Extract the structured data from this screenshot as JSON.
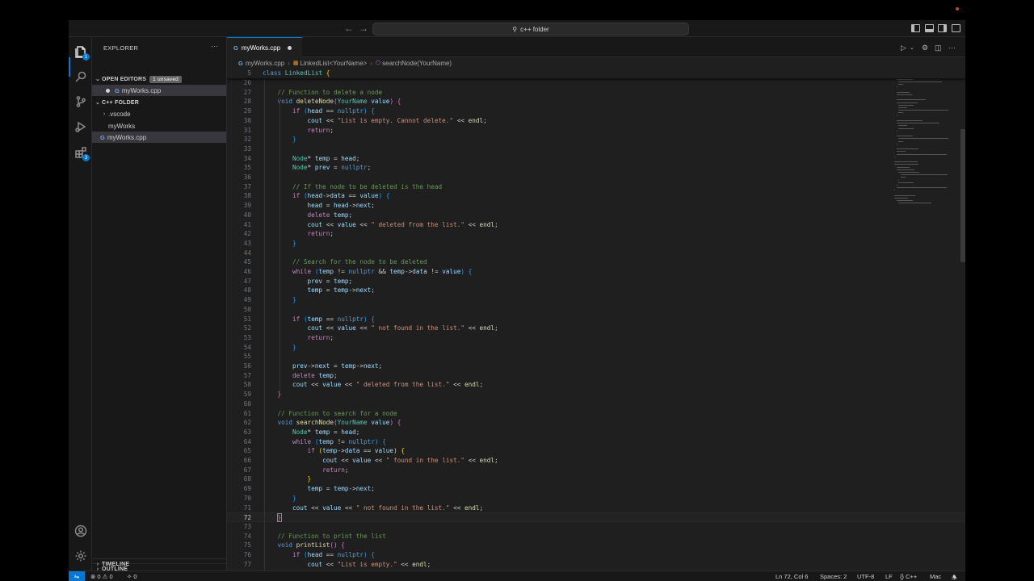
{
  "window": {
    "command_center": "c++ folder"
  },
  "sidebar": {
    "title": "EXPLORER",
    "open_editors": {
      "label": "OPEN EDITORS",
      "badge": "1 unsaved",
      "files": [
        "myWorks.cpp"
      ]
    },
    "folder": {
      "label": "C++ FOLDER",
      "items": [
        ".vscode",
        "myWorks",
        "myWorks.cpp"
      ]
    },
    "outline": "OUTLINE",
    "timeline": "TIMELINE"
  },
  "activity": {
    "explorer_badge": "1",
    "extensions_badge": "3"
  },
  "tab": {
    "label": "myWorks.cpp"
  },
  "breadcrumb": {
    "file": "myWorks.cpp",
    "class": "LinkedList<YourName>",
    "method": "searchNode(YourName)"
  },
  "editor": {
    "current_line": 72,
    "lines": [
      {
        "n": 5,
        "html": "<span class='kd'>class</span> <span class='t'>LinkedList</span> <span class='b1'>{</span>"
      },
      {
        "n": 26,
        "html": ""
      },
      {
        "n": 27,
        "html": "    <span class='c'>// Function to delete a node</span>"
      },
      {
        "n": 28,
        "html": "    <span class='kd'>void</span> <span class='f'>deleteNode</span><span class='b2'>(</span><span class='t'>YourName</span> <span class='v'>value</span><span class='b2'>)</span> <span class='b2'>{</span>"
      },
      {
        "n": 29,
        "html": "        <span class='k'>if</span> <span class='b3'>(</span><span class='v'>head</span> == <span class='kd'>nullptr</span><span class='b3'>)</span> <span class='b3'>{</span>"
      },
      {
        "n": 30,
        "html": "            <span class='v'>cout</span> &lt;&lt; <span class='s'>\"List is empty. Cannot delete.\"</span> &lt;&lt; <span class='f'>endl</span>;"
      },
      {
        "n": 31,
        "html": "            <span class='k'>return</span>;"
      },
      {
        "n": 32,
        "html": "        <span class='b3'>}</span>"
      },
      {
        "n": 33,
        "html": ""
      },
      {
        "n": 34,
        "html": "        <span class='t'>Node</span>* <span class='v'>temp</span> = <span class='v'>head</span>;"
      },
      {
        "n": 35,
        "html": "        <span class='t'>Node</span>* <span class='v'>prev</span> = <span class='kd'>nullptr</span>;"
      },
      {
        "n": 36,
        "html": ""
      },
      {
        "n": 37,
        "html": "        <span class='c'>// If the node to be deleted is the head</span>"
      },
      {
        "n": 38,
        "html": "        <span class='k'>if</span> <span class='b3'>(</span><span class='v'>head</span>-&gt;<span class='v'>data</span> == <span class='v'>value</span><span class='b3'>)</span> <span class='b3'>{</span>"
      },
      {
        "n": 39,
        "html": "            <span class='v'>head</span> = <span class='v'>head</span>-&gt;<span class='v'>next</span>;"
      },
      {
        "n": 40,
        "html": "            <span class='k'>delete</span> <span class='v'>temp</span>;"
      },
      {
        "n": 41,
        "html": "            <span class='v'>cout</span> &lt;&lt; <span class='v'>value</span> &lt;&lt; <span class='s'>\" deleted from the list.\"</span> &lt;&lt; <span class='f'>endl</span>;"
      },
      {
        "n": 42,
        "html": "            <span class='k'>return</span>;"
      },
      {
        "n": 43,
        "html": "        <span class='b3'>}</span>"
      },
      {
        "n": 44,
        "html": ""
      },
      {
        "n": 45,
        "html": "        <span class='c'>// Search for the node to be deleted</span>"
      },
      {
        "n": 46,
        "html": "        <span class='k'>while</span> <span class='b3'>(</span><span class='v'>temp</span> != <span class='kd'>nullptr</span> &amp;&amp; <span class='v'>temp</span>-&gt;<span class='v'>data</span> != <span class='v'>value</span><span class='b3'>)</span> <span class='b3'>{</span>"
      },
      {
        "n": 47,
        "html": "            <span class='v'>prev</span> = <span class='v'>temp</span>;"
      },
      {
        "n": 48,
        "html": "            <span class='v'>temp</span> = <span class='v'>temp</span>-&gt;<span class='v'>next</span>;"
      },
      {
        "n": 49,
        "html": "        <span class='b3'>}</span>"
      },
      {
        "n": 50,
        "html": ""
      },
      {
        "n": 51,
        "html": "        <span class='k'>if</span> <span class='b3'>(</span><span class='v'>temp</span> == <span class='kd'>nullptr</span><span class='b3'>)</span> <span class='b3'>{</span>"
      },
      {
        "n": 52,
        "html": "            <span class='v'>cout</span> &lt;&lt; <span class='v'>value</span> &lt;&lt; <span class='s'>\" not found in the list.\"</span> &lt;&lt; <span class='f'>endl</span>;"
      },
      {
        "n": 53,
        "html": "            <span class='k'>return</span>;"
      },
      {
        "n": 54,
        "html": "        <span class='b3'>}</span>"
      },
      {
        "n": 55,
        "html": ""
      },
      {
        "n": 56,
        "html": "        <span class='v'>prev</span>-&gt;<span class='v'>next</span> = <span class='v'>temp</span>-&gt;<span class='v'>next</span>;"
      },
      {
        "n": 57,
        "html": "        <span class='k'>delete</span> <span class='v'>temp</span>;"
      },
      {
        "n": 58,
        "html": "        <span class='v'>cout</span> &lt;&lt; <span class='v'>value</span> &lt;&lt; <span class='s'>\" deleted from the list.\"</span> &lt;&lt; <span class='f'>endl</span>;"
      },
      {
        "n": 59,
        "html": "    <span class='b2'>}</span>"
      },
      {
        "n": 60,
        "html": ""
      },
      {
        "n": 61,
        "html": "    <span class='c'>// Function to search for a node</span>"
      },
      {
        "n": 62,
        "html": "    <span class='kd'>void</span> <span class='f'>searchNode</span><span class='b2'>(</span><span class='t'>YourName</span> <span class='v'>value</span><span class='b2'>)</span> <span class='b2'>{</span>"
      },
      {
        "n": 63,
        "html": "        <span class='t'>Node</span>* <span class='v'>temp</span> = <span class='v'>head</span>;"
      },
      {
        "n": 64,
        "html": "        <span class='k'>while</span> <span class='b3'>(</span><span class='v'>temp</span> != <span class='kd'>nullptr</span><span class='b3'>)</span> <span class='b3'>{</span>"
      },
      {
        "n": 65,
        "html": "            <span class='k'>if</span> <span class='b1'>(</span><span class='v'>temp</span>-&gt;<span class='v'>data</span> == <span class='v'>value</span><span class='b1'>)</span> <span class='b1'>{</span>"
      },
      {
        "n": 66,
        "html": "                <span class='v'>cout</span> &lt;&lt; <span class='v'>value</span> &lt;&lt; <span class='s'>\" found in the list.\"</span> &lt;&lt; <span class='f'>endl</span>;"
      },
      {
        "n": 67,
        "html": "                <span class='k'>return</span>;"
      },
      {
        "n": 68,
        "html": "            <span class='b1'>}</span>"
      },
      {
        "n": 69,
        "html": "            <span class='v'>temp</span> = <span class='v'>temp</span>-&gt;<span class='v'>next</span>;"
      },
      {
        "n": 70,
        "html": "        <span class='b3'>}</span>"
      },
      {
        "n": 71,
        "html": "        <span class='v'>cout</span> &lt;&lt; <span class='v'>value</span> &lt;&lt; <span class='s'>\" not found in the list.\"</span> &lt;&lt; <span class='f'>endl</span>;"
      },
      {
        "n": 72,
        "html": "    <span class='b2' style='outline:1px solid #888;'>}</span>"
      },
      {
        "n": 73,
        "html": ""
      },
      {
        "n": 74,
        "html": "    <span class='c'>// Function to print the list</span>"
      },
      {
        "n": 75,
        "html": "    <span class='kd'>void</span> <span class='f'>printList</span><span class='b2'>()</span> <span class='b2'>{</span>"
      },
      {
        "n": 76,
        "html": "        <span class='k'>if</span> <span class='b3'>(</span><span class='v'>head</span> == <span class='kd'>nullptr</span><span class='b3'>)</span> <span class='b3'>{</span>"
      },
      {
        "n": 77,
        "html": "            <span class='v'>cout</span> &lt;&lt; <span class='s'>\"List is empty.\"</span> &lt;&lt; <span class='f'>endl</span>;"
      }
    ]
  },
  "statusbar": {
    "errors": "0",
    "warnings": "0",
    "ports": "0",
    "position": "Ln 72, Col 6",
    "spaces": "Spaces: 2",
    "encoding": "UTF-8",
    "eol": "LF",
    "language": "C++",
    "platform": "Mac"
  },
  "colors": {
    "accent": "#0078d4",
    "editor_bg": "#1f1f1f",
    "chrome_bg": "#181818"
  },
  "icons": [
    "files-icon",
    "search-icon",
    "source-control-icon",
    "run-debug-icon",
    "extensions-icon",
    "account-icon",
    "settings-gear-icon",
    "run-icon",
    "split-editor-icon",
    "more-icon",
    "bell-icon",
    "remote-icon"
  ]
}
